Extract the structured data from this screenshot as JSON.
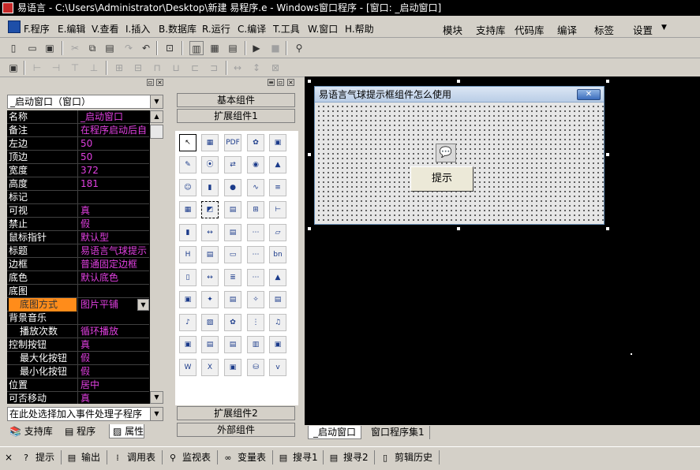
{
  "window": {
    "title": "易语言 - C:\\Users\\Administrator\\Desktop\\新建 易程序.e - Windows窗口程序 - [窗口: _启动窗口]"
  },
  "menu": {
    "items": [
      "F.程序",
      "E.编辑",
      "V.查看",
      "I.插入",
      "B.数据库",
      "R.运行",
      "C.编译",
      "T.工具",
      "W.窗口",
      "H.帮助"
    ],
    "right_items": [
      "模块",
      "支持库",
      "代码库",
      "编译",
      "标签",
      "设置"
    ]
  },
  "properties": {
    "object_selector": "_启动窗口（窗口）",
    "rows": [
      {
        "name": "名称",
        "value": "_启动窗口"
      },
      {
        "name": "备注",
        "value": "在程序启动后自"
      },
      {
        "name": "左边",
        "value": "50"
      },
      {
        "name": "顶边",
        "value": "50"
      },
      {
        "name": "宽度",
        "value": "372"
      },
      {
        "name": "高度",
        "value": "181"
      },
      {
        "name": "标记",
        "value": ""
      },
      {
        "name": "可视",
        "value": "真"
      },
      {
        "name": "禁止",
        "value": "假"
      },
      {
        "name": "鼠标指针",
        "value": "默认型"
      },
      {
        "name": "标题",
        "value": "易语言气球提示"
      },
      {
        "name": "边框",
        "value": "普通固定边框"
      },
      {
        "name": "底色",
        "value": "默认底色"
      },
      {
        "name": "底图",
        "value": ""
      },
      {
        "name": "底图方式",
        "value": "图片平铺"
      },
      {
        "name": "背景音乐",
        "value": ""
      },
      {
        "name": "播放次数",
        "value": "循环播放"
      },
      {
        "name": "控制按钮",
        "value": "真"
      },
      {
        "name": "最大化按钮",
        "value": "假"
      },
      {
        "name": "最小化按钮",
        "value": "假"
      },
      {
        "name": "位置",
        "value": "居中"
      },
      {
        "name": "可否移动",
        "value": "真"
      }
    ],
    "event_selector": "在此处选择加入事件处理子程序"
  },
  "left_tabs": [
    "支持库",
    "程序",
    "属性"
  ],
  "components": {
    "group_basic": "基本组件",
    "group_ext1": "扩展组件1",
    "group_ext2": "扩展组件2",
    "group_external": "外部组件"
  },
  "designer": {
    "form_title": "易语言气球提示框组件怎么使用",
    "button_label": "提示",
    "tabs": [
      "_启动窗口",
      "窗口程序集1"
    ]
  },
  "bottom_tabs": [
    "提示",
    "输出",
    "调用表",
    "监视表",
    "变量表",
    "搜寻1",
    "搜寻2",
    "剪辑历史"
  ]
}
